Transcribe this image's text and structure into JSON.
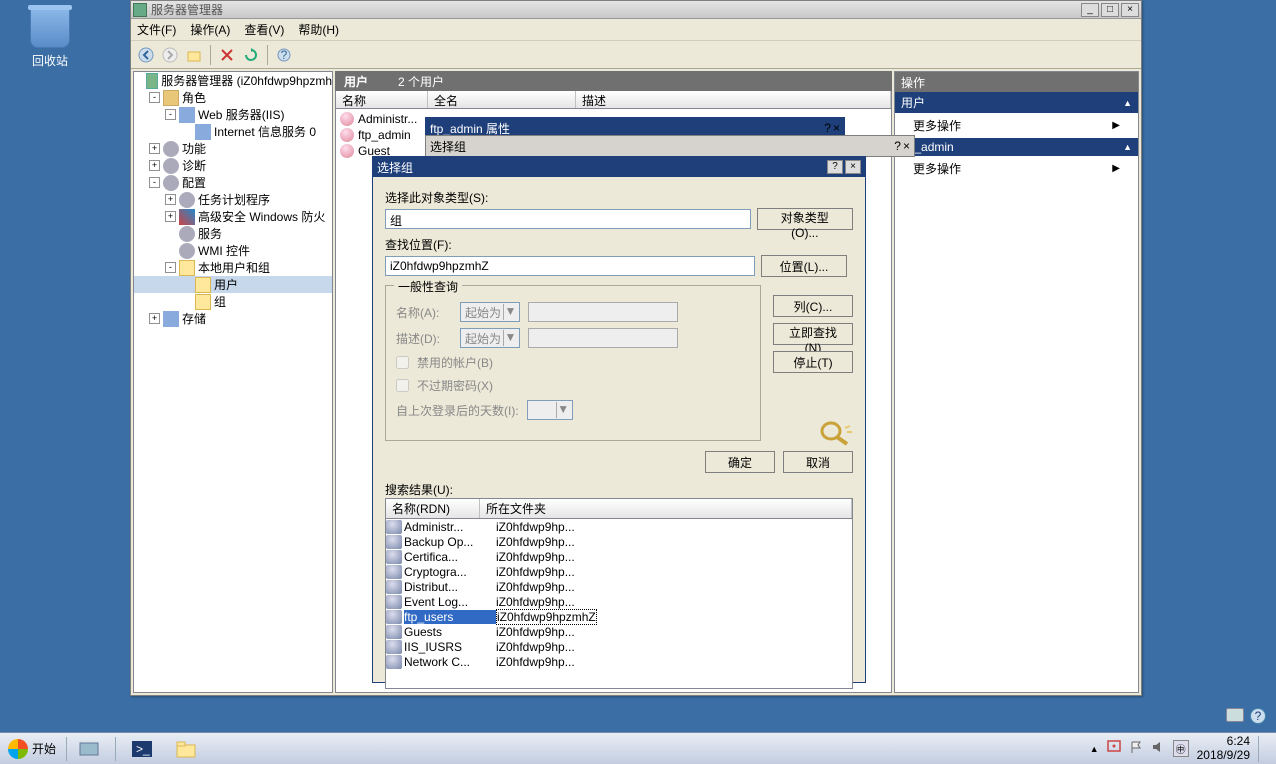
{
  "desktop": {
    "recycle": "回收站"
  },
  "window": {
    "title": "服务器管理器",
    "btn_min": "_",
    "btn_max": "□",
    "btn_close": "×"
  },
  "menu": {
    "file": "文件(F)",
    "action": "操作(A)",
    "view": "查看(V)",
    "help": "帮助(H)"
  },
  "tree": {
    "root": "服务器管理器 (iZ0hfdwp9hpzmh",
    "roles": "角色",
    "web": "Web 服务器(IIS)",
    "iis": "Internet 信息服务 0",
    "features": "功能",
    "diag": "诊断",
    "config": "配置",
    "task": "任务计划程序",
    "fw": "高级安全 Windows 防火",
    "svc": "服务",
    "wmi": "WMI 控件",
    "lug": "本地用户和组",
    "users": "用户",
    "groups": "组",
    "storage": "存储"
  },
  "mid": {
    "header_title": "用户",
    "header_count": "2 个用户",
    "col_name": "名称",
    "col_full": "全名",
    "col_desc": "描述",
    "rows": [
      "Administr...",
      "ftp_admin",
      "Guest"
    ]
  },
  "actions": {
    "header": "操作",
    "sec1": "用户",
    "more": "更多操作",
    "sec2": "ftp_admin"
  },
  "dlg1": {
    "title": "ftp_admin 属性"
  },
  "dlg2": {
    "title": "选择组",
    "help": "?",
    "close": "×"
  },
  "dlg3": {
    "title": "选择组",
    "label_objtype": "选择此对象类型(S):",
    "val_objtype": "组",
    "btn_objtype": "对象类型(O)...",
    "label_loc": "查找位置(F):",
    "val_loc": "iZ0hfdwp9hpzmhZ",
    "btn_loc": "位置(L)...",
    "group_common": "一般性查询",
    "row_name": "名称(A):",
    "row_desc": "描述(D):",
    "combo_start": "起始为",
    "chk_disabled": "禁用的帐户(B)",
    "chk_noexpire": "不过期密码(X)",
    "row_days": "自上次登录后的天数(I):",
    "btn_columns": "列(C)...",
    "btn_findnow": "立即查找(N)",
    "btn_stop": "停止(T)",
    "btn_ok": "确定",
    "btn_cancel": "取消",
    "results_label": "搜索结果(U):",
    "col_rdn": "名称(RDN)",
    "col_folder": "所在文件夹",
    "results": [
      {
        "n": "Administr...",
        "f": "iZ0hfdwp9hp..."
      },
      {
        "n": "Backup Op...",
        "f": "iZ0hfdwp9hp..."
      },
      {
        "n": "Certifica...",
        "f": "iZ0hfdwp9hp..."
      },
      {
        "n": "Cryptogra...",
        "f": "iZ0hfdwp9hp..."
      },
      {
        "n": "Distribut...",
        "f": "iZ0hfdwp9hp..."
      },
      {
        "n": "Event Log...",
        "f": "iZ0hfdwp9hp..."
      },
      {
        "n": "ftp_users",
        "f": "iZ0hfdwp9hpzmhZ",
        "sel": true
      },
      {
        "n": "Guests",
        "f": "iZ0hfdwp9hp..."
      },
      {
        "n": "IIS_IUSRS",
        "f": "iZ0hfdwp9hp..."
      },
      {
        "n": "Network C...",
        "f": "iZ0hfdwp9hp..."
      }
    ]
  },
  "taskbar": {
    "start": "开始",
    "time": "6:24",
    "date": "2018/9/29"
  }
}
